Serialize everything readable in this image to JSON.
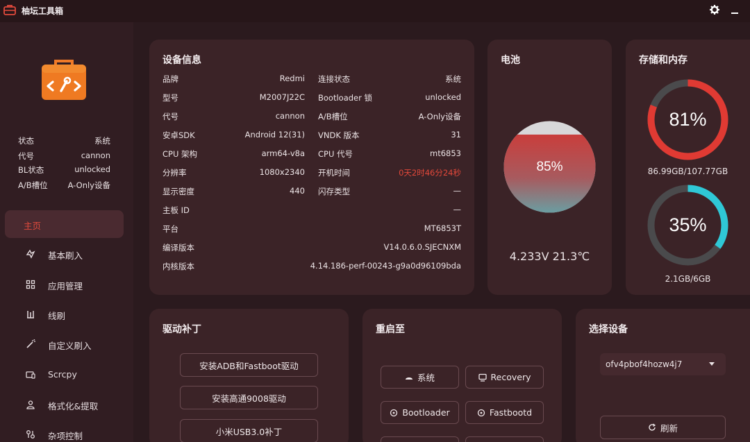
{
  "app": {
    "title": "柚坛工具箱"
  },
  "colors": {
    "accent": "#e24a3c",
    "ring_red": "#e03a33",
    "ring_cyan": "#2fc8d6",
    "ring_track": "#4a4a4c"
  },
  "sidebar": {
    "status": [
      {
        "k": "状态",
        "v": "系统"
      },
      {
        "k": "代号",
        "v": "cannon"
      },
      {
        "k": "BL状态",
        "v": "unlocked"
      },
      {
        "k": "A/B槽位",
        "v": "A-Only设备"
      }
    ],
    "nav": [
      {
        "label": "主页",
        "icon": "home-icon",
        "active": true
      },
      {
        "label": "基本刷入",
        "icon": "flash-icon"
      },
      {
        "label": "应用管理",
        "icon": "apps-icon"
      },
      {
        "label": "线刷",
        "icon": "line-flash-icon"
      },
      {
        "label": "自定义刷入",
        "icon": "wand-icon"
      },
      {
        "label": "Scrcpy",
        "icon": "screen-icon"
      },
      {
        "label": "格式化&提取",
        "icon": "format-icon"
      },
      {
        "label": "杂项控制",
        "icon": "misc-icon"
      }
    ]
  },
  "device_info": {
    "title": "设备信息",
    "left": [
      {
        "k": "品牌",
        "v": "Redmi"
      },
      {
        "k": "型号",
        "v": "M2007J22C"
      },
      {
        "k": "代号",
        "v": "cannon"
      },
      {
        "k": "安卓SDK",
        "v": "Android 12(31)"
      },
      {
        "k": "CPU 架构",
        "v": "arm64-v8a"
      },
      {
        "k": "分辨率",
        "v": "1080x2340"
      },
      {
        "k": "显示密度",
        "v": "440"
      }
    ],
    "right": [
      {
        "k": "连接状态",
        "v": "系统"
      },
      {
        "k": "Bootloader 锁",
        "v": "unlocked"
      },
      {
        "k": "A/B槽位",
        "v": "A-Only设备"
      },
      {
        "k": "VNDK 版本",
        "v": "31"
      },
      {
        "k": "CPU 代号",
        "v": "mt6853"
      },
      {
        "k": "开机时间",
        "v": "0天2时46分24秒"
      },
      {
        "k": "闪存类型",
        "v": "—"
      }
    ],
    "full": [
      {
        "k": "主板 ID",
        "v": "—"
      },
      {
        "k": "平台",
        "v": "MT6853T"
      },
      {
        "k": "编译版本",
        "v": "V14.0.6.0.SJECNXM"
      },
      {
        "k": "内核版本",
        "v": "4.14.186-perf-00243-g9a0d96109bda"
      }
    ]
  },
  "battery": {
    "title": "电池",
    "level": 85,
    "level_text": "85%",
    "voltage_temp": "4.233V 21.3℃"
  },
  "storage": {
    "title": "存储和内存",
    "storage_pct": 81,
    "storage_text": "81%",
    "storage_detail": "86.99GB/107.77GB",
    "memory_pct": 35,
    "memory_text": "35%",
    "memory_detail": "2.1GB/6GB"
  },
  "driver": {
    "title": "驱动补丁",
    "buttons": [
      "安装ADB和Fastboot驱动",
      "安装高通9008驱动",
      "小米USB3.0补丁"
    ]
  },
  "reboot": {
    "title": "重启至",
    "system": "系统",
    "recovery": "Recovery",
    "bootloader": "Bootloader",
    "fastbootd": "Fastbootd"
  },
  "select_device": {
    "title": "选择设备",
    "selected": "ofv4pbof4hozw4j7",
    "refresh": "刷新"
  }
}
